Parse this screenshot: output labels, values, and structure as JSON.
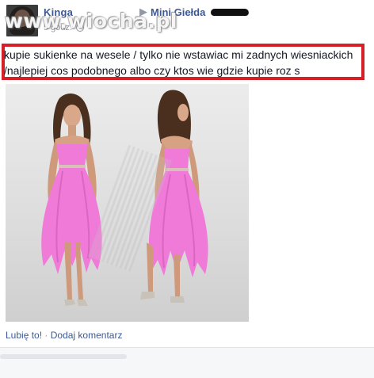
{
  "post": {
    "author": "Kinga",
    "arrow": "▶",
    "group": "Mini Giełda",
    "time": "5 godz.",
    "message_line1": "kupie sukienke na wesele / tylko nie wstawiac mi zadnych wiesniackich",
    "message_line2": "/najlepiej cos podobnego albo czy ktos wie gdzie kupie roz s",
    "like_label": "Lubię to!",
    "separator": "·",
    "comment_label": "Dodaj komentarz"
  },
  "watermark": "www.wiocha.pl",
  "colors": {
    "link": "#3b5998",
    "highlight_border": "#d42026",
    "dress_pink": "#f07ad8"
  }
}
